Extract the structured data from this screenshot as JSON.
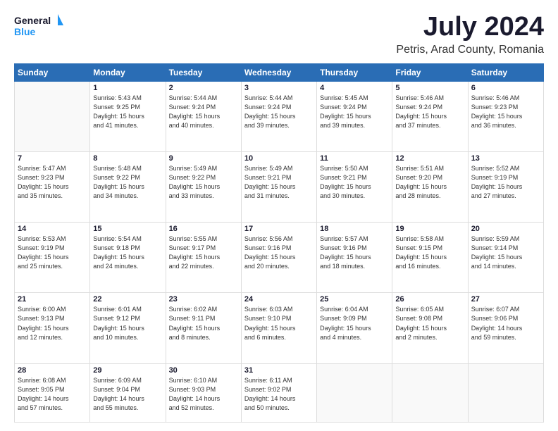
{
  "header": {
    "logo_line1": "General",
    "logo_line2": "Blue",
    "main_title": "July 2024",
    "subtitle": "Petris, Arad County, Romania"
  },
  "calendar": {
    "days_of_week": [
      "Sunday",
      "Monday",
      "Tuesday",
      "Wednesday",
      "Thursday",
      "Friday",
      "Saturday"
    ],
    "weeks": [
      [
        {
          "num": "",
          "info": ""
        },
        {
          "num": "1",
          "info": "Sunrise: 5:43 AM\nSunset: 9:25 PM\nDaylight: 15 hours\nand 41 minutes."
        },
        {
          "num": "2",
          "info": "Sunrise: 5:44 AM\nSunset: 9:24 PM\nDaylight: 15 hours\nand 40 minutes."
        },
        {
          "num": "3",
          "info": "Sunrise: 5:44 AM\nSunset: 9:24 PM\nDaylight: 15 hours\nand 39 minutes."
        },
        {
          "num": "4",
          "info": "Sunrise: 5:45 AM\nSunset: 9:24 PM\nDaylight: 15 hours\nand 39 minutes."
        },
        {
          "num": "5",
          "info": "Sunrise: 5:46 AM\nSunset: 9:24 PM\nDaylight: 15 hours\nand 37 minutes."
        },
        {
          "num": "6",
          "info": "Sunrise: 5:46 AM\nSunset: 9:23 PM\nDaylight: 15 hours\nand 36 minutes."
        }
      ],
      [
        {
          "num": "7",
          "info": "Sunrise: 5:47 AM\nSunset: 9:23 PM\nDaylight: 15 hours\nand 35 minutes."
        },
        {
          "num": "8",
          "info": "Sunrise: 5:48 AM\nSunset: 9:22 PM\nDaylight: 15 hours\nand 34 minutes."
        },
        {
          "num": "9",
          "info": "Sunrise: 5:49 AM\nSunset: 9:22 PM\nDaylight: 15 hours\nand 33 minutes."
        },
        {
          "num": "10",
          "info": "Sunrise: 5:49 AM\nSunset: 9:21 PM\nDaylight: 15 hours\nand 31 minutes."
        },
        {
          "num": "11",
          "info": "Sunrise: 5:50 AM\nSunset: 9:21 PM\nDaylight: 15 hours\nand 30 minutes."
        },
        {
          "num": "12",
          "info": "Sunrise: 5:51 AM\nSunset: 9:20 PM\nDaylight: 15 hours\nand 28 minutes."
        },
        {
          "num": "13",
          "info": "Sunrise: 5:52 AM\nSunset: 9:19 PM\nDaylight: 15 hours\nand 27 minutes."
        }
      ],
      [
        {
          "num": "14",
          "info": "Sunrise: 5:53 AM\nSunset: 9:19 PM\nDaylight: 15 hours\nand 25 minutes."
        },
        {
          "num": "15",
          "info": "Sunrise: 5:54 AM\nSunset: 9:18 PM\nDaylight: 15 hours\nand 24 minutes."
        },
        {
          "num": "16",
          "info": "Sunrise: 5:55 AM\nSunset: 9:17 PM\nDaylight: 15 hours\nand 22 minutes."
        },
        {
          "num": "17",
          "info": "Sunrise: 5:56 AM\nSunset: 9:16 PM\nDaylight: 15 hours\nand 20 minutes."
        },
        {
          "num": "18",
          "info": "Sunrise: 5:57 AM\nSunset: 9:16 PM\nDaylight: 15 hours\nand 18 minutes."
        },
        {
          "num": "19",
          "info": "Sunrise: 5:58 AM\nSunset: 9:15 PM\nDaylight: 15 hours\nand 16 minutes."
        },
        {
          "num": "20",
          "info": "Sunrise: 5:59 AM\nSunset: 9:14 PM\nDaylight: 15 hours\nand 14 minutes."
        }
      ],
      [
        {
          "num": "21",
          "info": "Sunrise: 6:00 AM\nSunset: 9:13 PM\nDaylight: 15 hours\nand 12 minutes."
        },
        {
          "num": "22",
          "info": "Sunrise: 6:01 AM\nSunset: 9:12 PM\nDaylight: 15 hours\nand 10 minutes."
        },
        {
          "num": "23",
          "info": "Sunrise: 6:02 AM\nSunset: 9:11 PM\nDaylight: 15 hours\nand 8 minutes."
        },
        {
          "num": "24",
          "info": "Sunrise: 6:03 AM\nSunset: 9:10 PM\nDaylight: 15 hours\nand 6 minutes."
        },
        {
          "num": "25",
          "info": "Sunrise: 6:04 AM\nSunset: 9:09 PM\nDaylight: 15 hours\nand 4 minutes."
        },
        {
          "num": "26",
          "info": "Sunrise: 6:05 AM\nSunset: 9:08 PM\nDaylight: 15 hours\nand 2 minutes."
        },
        {
          "num": "27",
          "info": "Sunrise: 6:07 AM\nSunset: 9:06 PM\nDaylight: 14 hours\nand 59 minutes."
        }
      ],
      [
        {
          "num": "28",
          "info": "Sunrise: 6:08 AM\nSunset: 9:05 PM\nDaylight: 14 hours\nand 57 minutes."
        },
        {
          "num": "29",
          "info": "Sunrise: 6:09 AM\nSunset: 9:04 PM\nDaylight: 14 hours\nand 55 minutes."
        },
        {
          "num": "30",
          "info": "Sunrise: 6:10 AM\nSunset: 9:03 PM\nDaylight: 14 hours\nand 52 minutes."
        },
        {
          "num": "31",
          "info": "Sunrise: 6:11 AM\nSunset: 9:02 PM\nDaylight: 14 hours\nand 50 minutes."
        },
        {
          "num": "",
          "info": ""
        },
        {
          "num": "",
          "info": ""
        },
        {
          "num": "",
          "info": ""
        }
      ]
    ]
  }
}
